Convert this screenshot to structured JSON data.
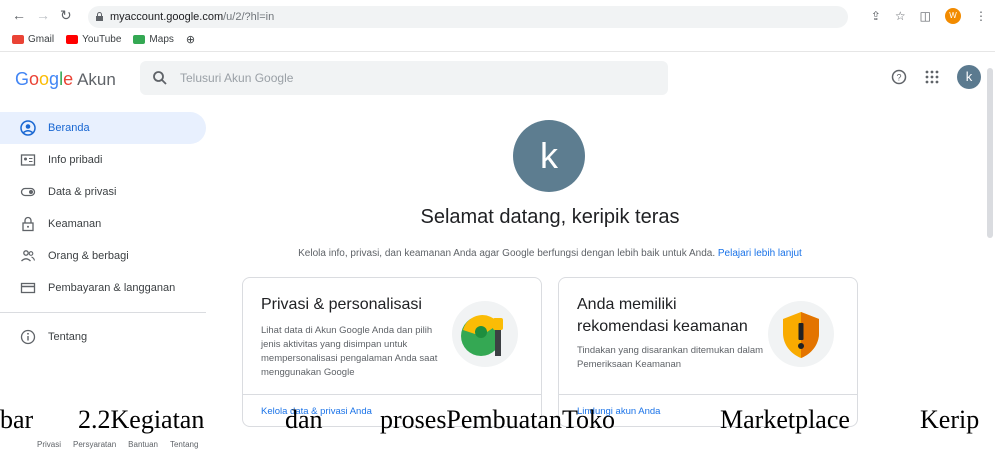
{
  "browser": {
    "url_host": "myaccount.google.com",
    "url_path": "/u/2/?hl=in",
    "ext_badge": "W",
    "profile_initial": "k",
    "bookmarks": [
      {
        "label": "Gmail",
        "color": "#ea4335"
      },
      {
        "label": "YouTube",
        "color": "#ff0000"
      },
      {
        "label": "Maps",
        "color": "#34a853"
      }
    ]
  },
  "header": {
    "logo_google": "Google",
    "logo_akun": "Akun",
    "search_placeholder": "Telusuri Akun Google",
    "avatar_initial": "k"
  },
  "sidebar": {
    "items": [
      {
        "label": "Beranda",
        "icon": "account-circle-icon",
        "active": true
      },
      {
        "label": "Info pribadi",
        "icon": "id-card-icon"
      },
      {
        "label": "Data & privasi",
        "icon": "toggle-icon"
      },
      {
        "label": "Keamanan",
        "icon": "lock-icon"
      },
      {
        "label": "Orang & berbagi",
        "icon": "people-icon"
      },
      {
        "label": "Pembayaran & langganan",
        "icon": "credit-card-icon"
      }
    ],
    "about": {
      "label": "Tentang",
      "icon": "info-icon"
    }
  },
  "main": {
    "avatar_initial": "k",
    "welcome": "Selamat datang, keripik teras",
    "subtitle": "Kelola info, privasi, dan keamanan Anda agar Google berfungsi dengan lebih baik untuk Anda.",
    "learn_more": "Pelajari lebih lanjut",
    "cards": [
      {
        "title": "Privasi & personalisasi",
        "body": "Lihat data di Akun Google Anda dan pilih jenis aktivitas yang disimpan untuk mempersonalisasi pengalaman Anda saat menggunakan Google",
        "link": "Kelola data & privasi Anda"
      },
      {
        "title": "Anda memiliki rekomendasi keamanan",
        "body": "Tindakan yang disarankan ditemukan dalam Pemeriksaan Keamanan",
        "link": "Lindungi akun Anda"
      }
    ]
  },
  "caption": {
    "words": [
      "bar",
      "2.2Kegiatan",
      "dan",
      "prosesPembuatanToko",
      "Marketplace",
      "Kerip"
    ]
  },
  "footer": {
    "links": [
      "Privasi",
      "Persyaratan",
      "Bantuan",
      "Tentang"
    ]
  }
}
